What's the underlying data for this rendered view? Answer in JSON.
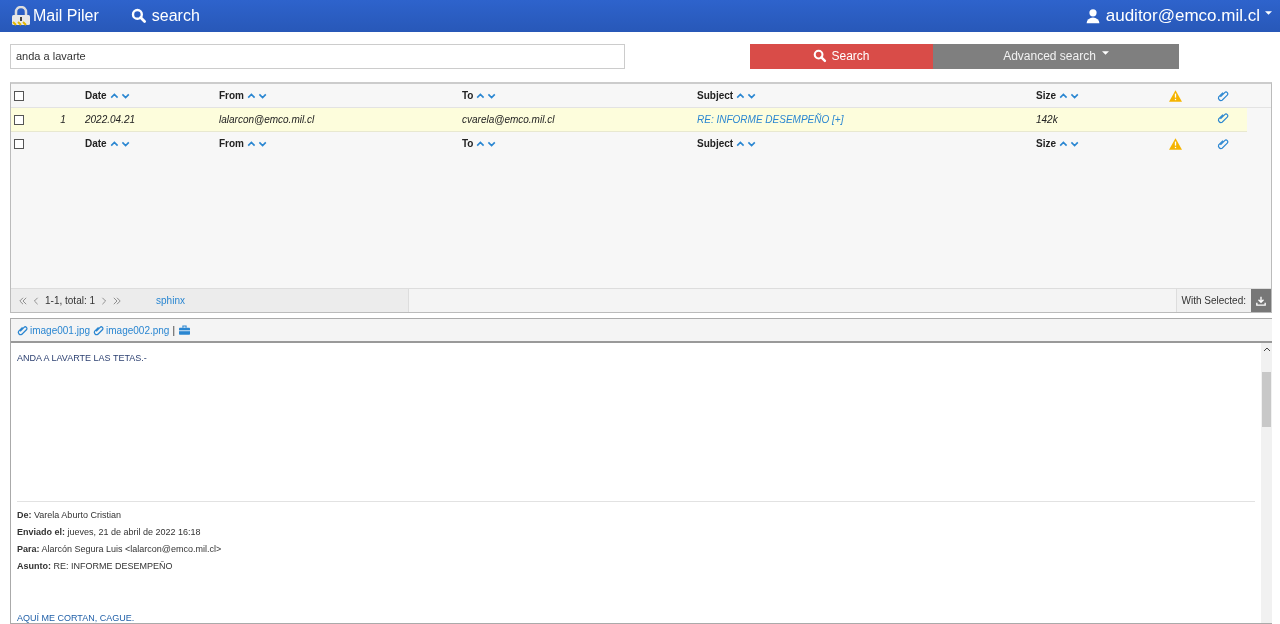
{
  "header": {
    "brand": "Mail Piler",
    "nav": "search",
    "user": "auditor@emco.mil.cl"
  },
  "search": {
    "value": "anda a lavarte",
    "button": "Search",
    "advanced": "Advanced search"
  },
  "table": {
    "columns": [
      "Date",
      "From",
      "To",
      "Subject",
      "Size"
    ],
    "footer_columns": [
      "Date",
      "From",
      "To",
      "Subject",
      "Size"
    ],
    "header_checked": false,
    "footer_checked": false,
    "rows": [
      {
        "number": "1",
        "date": "2022.04.21",
        "from": "lalarcon@emco.mil.cl",
        "to": "cvarela@emco.mil.cl",
        "subject": "RE: INFORME DESEMPEÑO [+]",
        "size": "142k",
        "checked": false,
        "selected": true
      }
    ]
  },
  "pager": {
    "range": "1-1, total: 1",
    "engine": "sphinx",
    "with_selected": "With Selected:"
  },
  "preview": {
    "attachments": [
      "image001.jpg",
      "image002.png"
    ],
    "separator": "|",
    "body": "ANDA A LAVARTE LAS TETAS.-",
    "quoted_headers": [
      {
        "label": "De:",
        "value": "Varela Aburto Cristian"
      },
      {
        "label": "Enviado el:",
        "value": "jueves, 21 de abril de 2022 16:18"
      },
      {
        "label": "Para:",
        "value": "Alarcón Segura Luis <lalarcon@emco.mil.cl>"
      },
      {
        "label": "Asunto:",
        "value": "RE: INFORME DESEMPEÑO"
      }
    ],
    "reply": "AQUÍ ME CORTAN, CAGUE."
  }
}
